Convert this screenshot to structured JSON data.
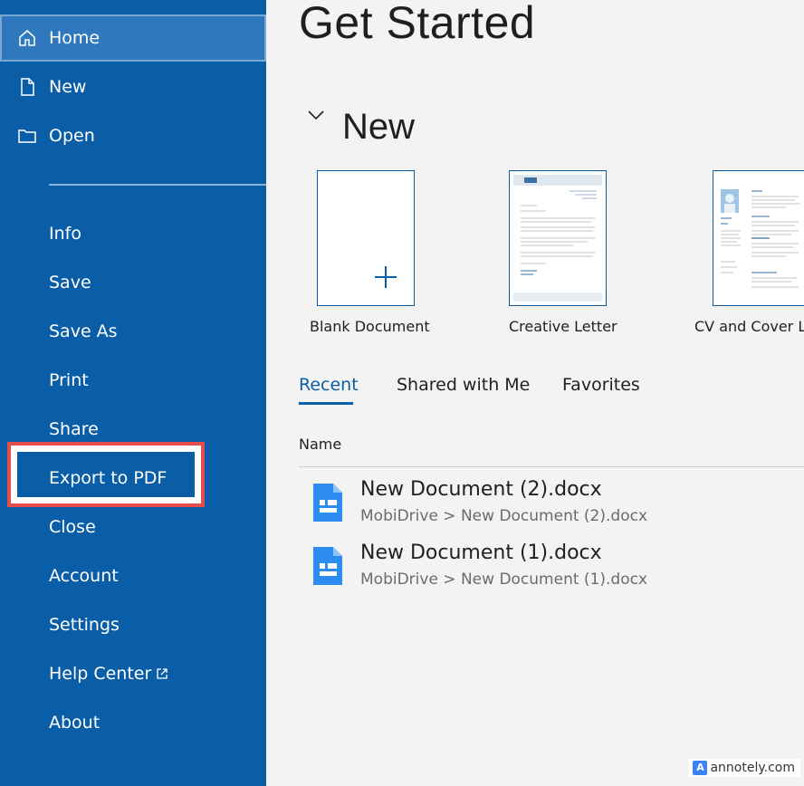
{
  "sidebar": {
    "items": [
      {
        "label": "Home",
        "icon": "home-icon"
      },
      {
        "label": "New",
        "icon": "document-icon"
      },
      {
        "label": "Open",
        "icon": "folder-icon"
      },
      {
        "label": "Info"
      },
      {
        "label": "Save"
      },
      {
        "label": "Save As"
      },
      {
        "label": "Print"
      },
      {
        "label": "Share"
      },
      {
        "label": "Export to PDF"
      },
      {
        "label": "Close"
      },
      {
        "label": "Account"
      },
      {
        "label": "Settings"
      },
      {
        "label": "Help Center",
        "icon": "external-link-icon"
      },
      {
        "label": "About"
      }
    ]
  },
  "main": {
    "title": "Get Started",
    "new_section": "New",
    "templates": [
      {
        "name": "Blank Document"
      },
      {
        "name": "Creative Letter"
      },
      {
        "name": "CV and Cover Le"
      }
    ],
    "tabs": [
      {
        "label": "Recent"
      },
      {
        "label": "Shared with Me"
      },
      {
        "label": "Favorites"
      }
    ],
    "column_header": "Name",
    "files": [
      {
        "name": "New Document (2).docx",
        "path": "MobiDrive > New Document (2).docx"
      },
      {
        "name": "New Document (1).docx",
        "path": "MobiDrive > New Document (1).docx"
      }
    ]
  },
  "watermark": {
    "icon_letter": "A",
    "text": "annotely.com"
  },
  "colors": {
    "sidebar": "#0a5ea8",
    "accent": "#0a5ea8",
    "highlight": "#e74c4c"
  }
}
